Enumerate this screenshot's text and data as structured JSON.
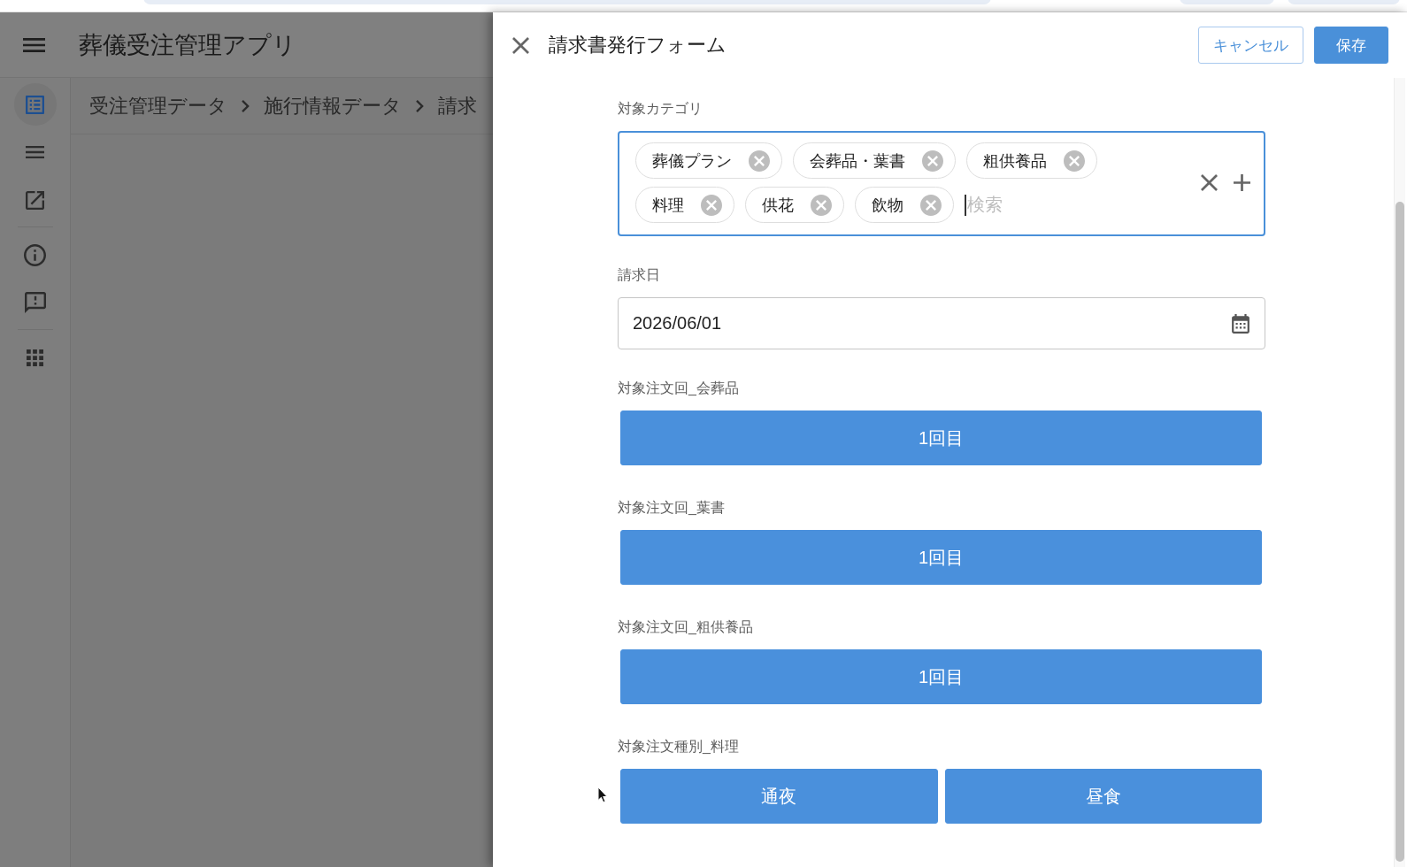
{
  "app_bar": {
    "title": "葬儀受注管理アプリ"
  },
  "nav_rail": {
    "groups": [
      {
        "items": [
          {
            "selected": true
          },
          {
            "selected": false
          },
          {
            "selected": false
          }
        ]
      },
      {
        "items": [
          {
            "selected": false
          },
          {
            "selected": false
          }
        ]
      },
      {
        "items": [
          {
            "selected": false
          }
        ]
      }
    ]
  },
  "breadcrumb": {
    "items": [
      "受注管理データ",
      "施行情報データ",
      "請求"
    ]
  },
  "panel": {
    "title": "請求書発行フォーム",
    "actions": [
      {
        "label": "キャンセル",
        "kind": "outlined"
      },
      {
        "label": "保存",
        "kind": "filled"
      }
    ],
    "fields": [
      {
        "kind": "tags",
        "label": "対象カテゴリ",
        "focused": true,
        "chips": [
          "葬儀プラン",
          "会葬品・葉書",
          "粗供養品",
          "料理",
          "供花",
          "飲物"
        ],
        "placeholder": "検索"
      },
      {
        "kind": "date",
        "label": "請求日",
        "value": "2026/06/01"
      },
      {
        "kind": "options",
        "label": "対象注文回_会葬品",
        "options": [
          {
            "label": "1回目",
            "selected": true
          }
        ]
      },
      {
        "kind": "options",
        "label": "対象注文回_葉書",
        "options": [
          {
            "label": "1回目",
            "selected": true
          }
        ]
      },
      {
        "kind": "options",
        "label": "対象注文回_粗供養品",
        "options": [
          {
            "label": "1回目",
            "selected": true
          }
        ]
      },
      {
        "kind": "options",
        "label": "対象注文種別_料理",
        "options": [
          {
            "label": "通夜",
            "selected": true
          },
          {
            "label": "昼食",
            "selected": true
          }
        ]
      }
    ]
  }
}
